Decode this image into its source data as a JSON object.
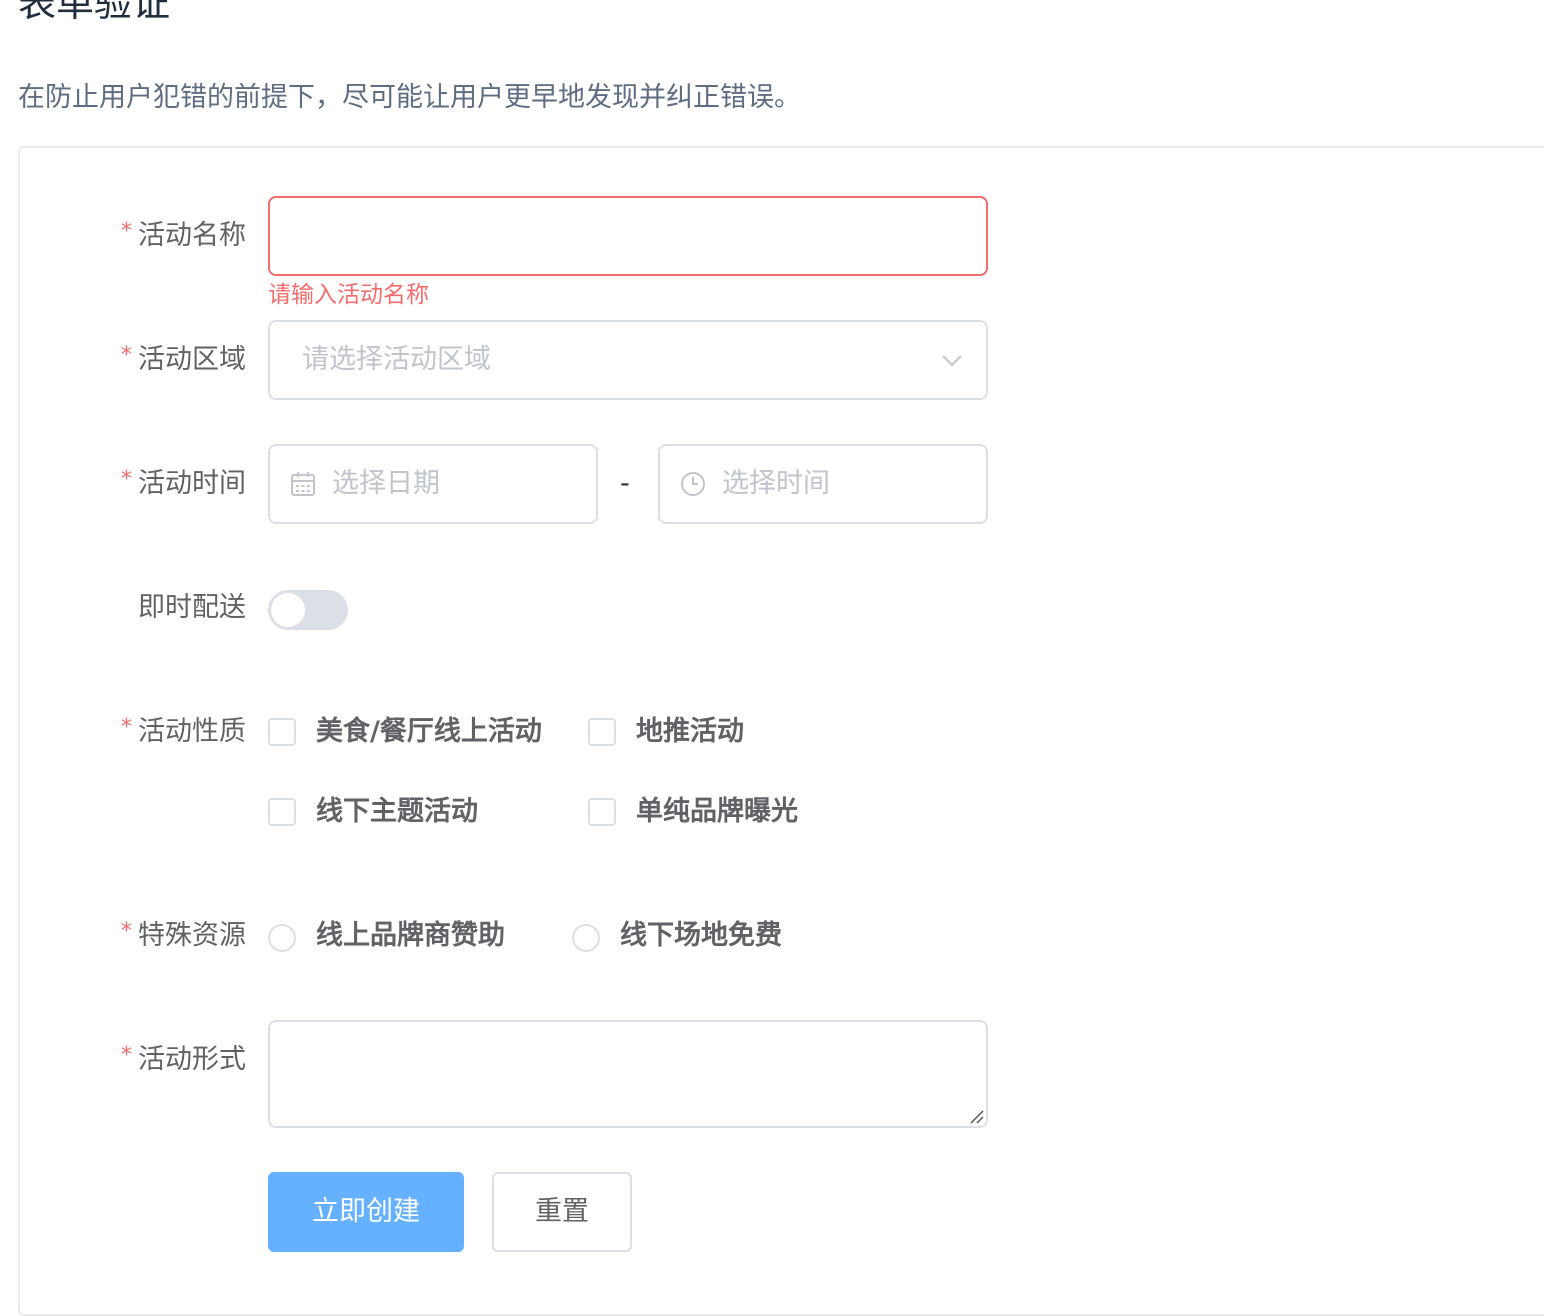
{
  "page": {
    "title": "表单验证",
    "description": "在防止用户犯错的前提下，尽可能让用户更早地发现并纠正错误。"
  },
  "form": {
    "required_mark": "*",
    "activity_name": {
      "label": "活动名称",
      "value": "",
      "error": "请输入活动名称"
    },
    "activity_region": {
      "label": "活动区域",
      "placeholder": "请选择活动区域"
    },
    "activity_time": {
      "label": "活动时间",
      "date_placeholder": "选择日期",
      "separator": "-",
      "time_placeholder": "选择时间"
    },
    "instant_delivery": {
      "label": "即时配送",
      "enabled": false
    },
    "activity_type": {
      "label": "活动性质",
      "options": [
        {
          "label": "美食/餐厅线上活动",
          "checked": false
        },
        {
          "label": "地推活动",
          "checked": false
        },
        {
          "label": "线下主题活动",
          "checked": false
        },
        {
          "label": "单纯品牌曝光",
          "checked": false
        }
      ]
    },
    "special_resource": {
      "label": "特殊资源",
      "options": [
        {
          "label": "线上品牌商赞助",
          "selected": false
        },
        {
          "label": "线下场地免费",
          "selected": false
        }
      ]
    },
    "activity_form": {
      "label": "活动形式",
      "value": ""
    }
  },
  "buttons": {
    "submit": "立即创建",
    "reset": "重置"
  },
  "colors": {
    "error": "#f56c6c",
    "primary": "#66b1ff",
    "border": "#dcdfe6",
    "placeholder": "#c0c4cc",
    "label": "#606266"
  }
}
